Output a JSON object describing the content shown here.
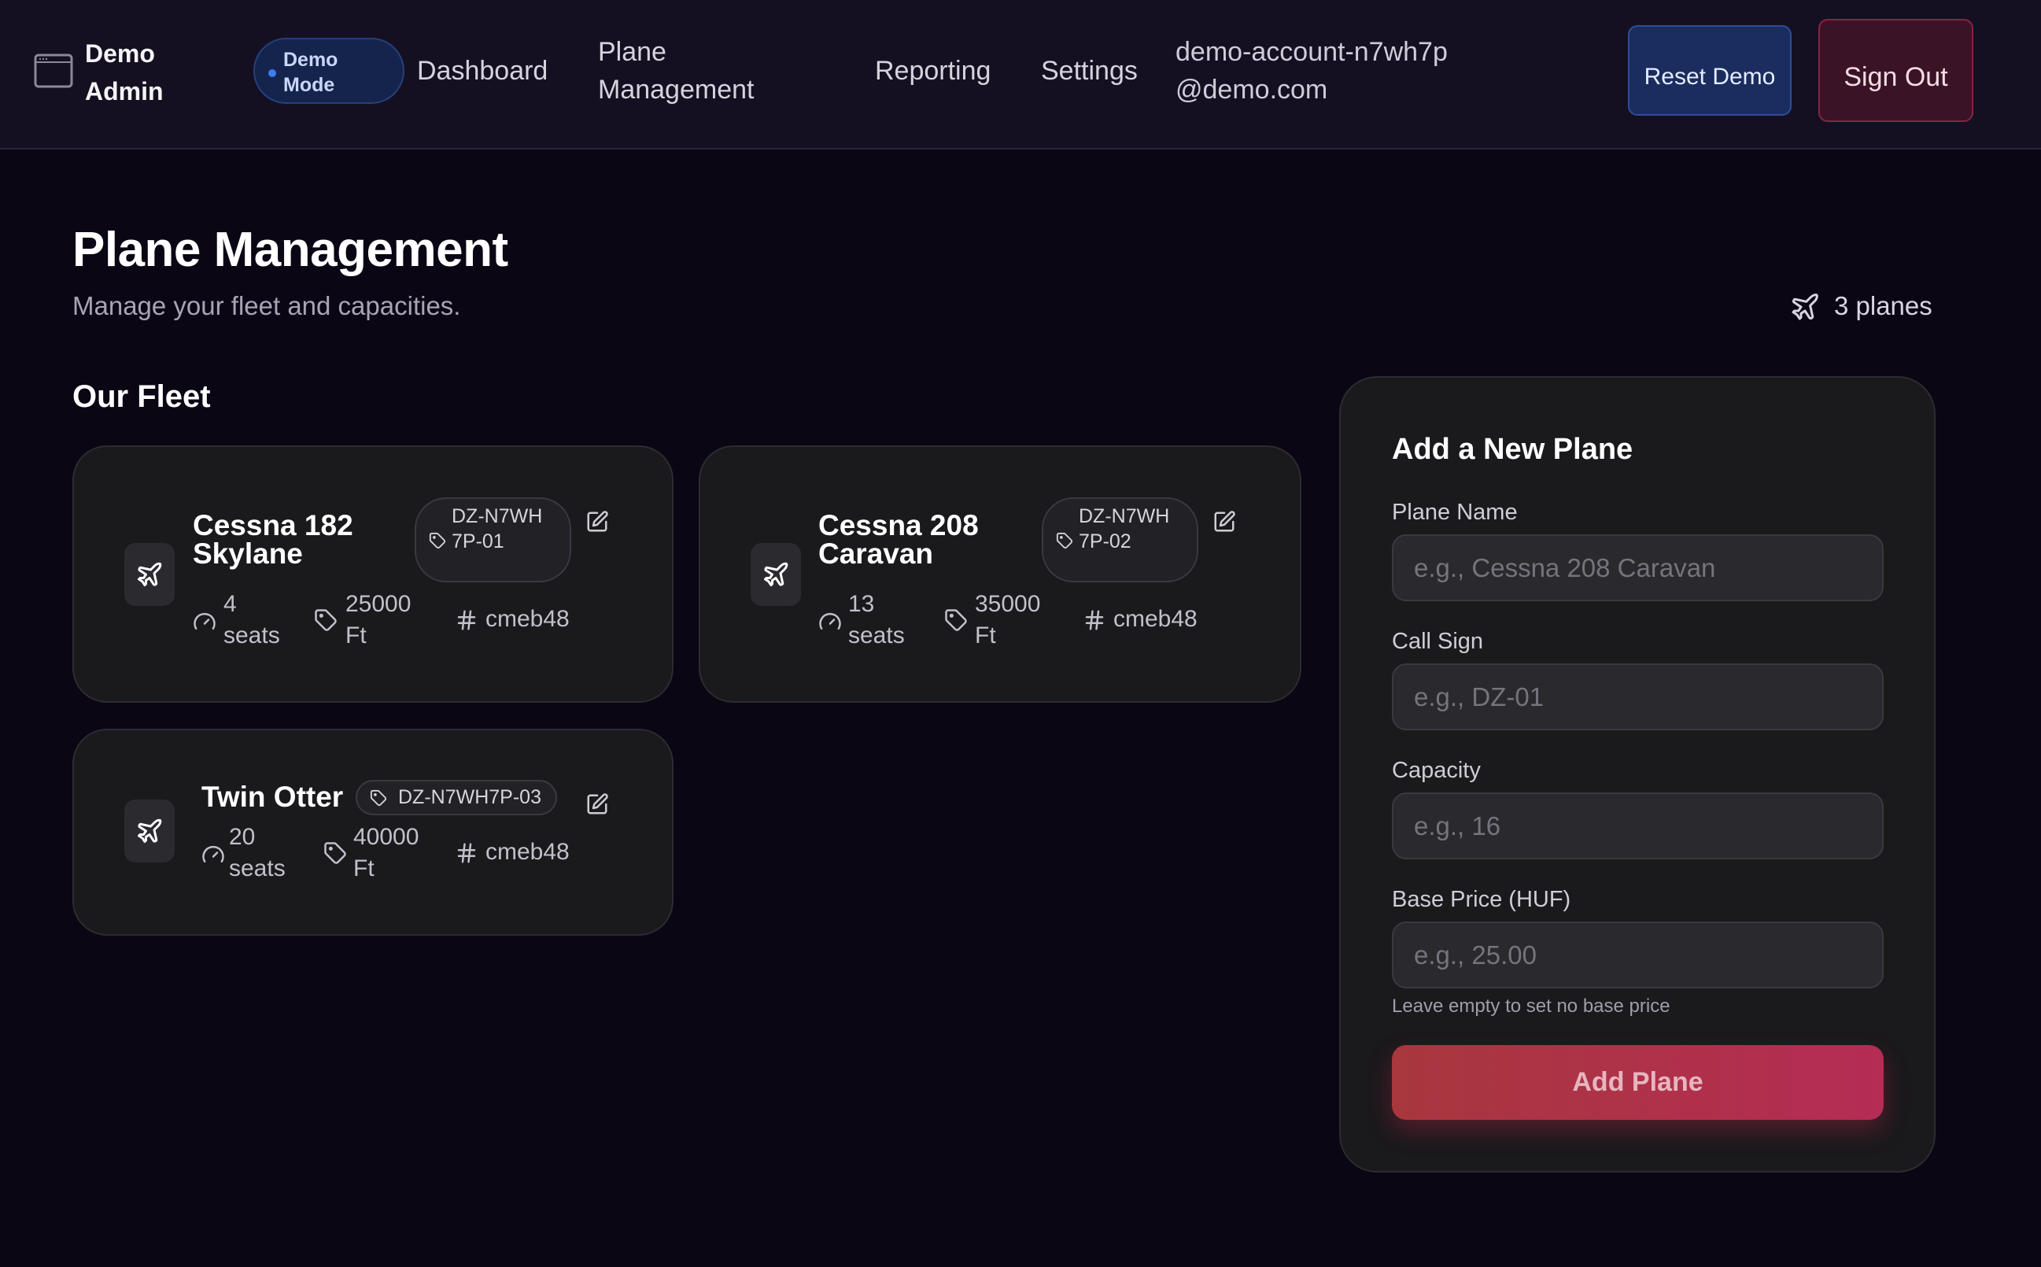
{
  "header": {
    "brand": "Demo Admin",
    "demo_badge": "Demo Mode",
    "nav": {
      "dashboard": "Dashboard",
      "plane_management": "Plane Management",
      "reporting": "Reporting",
      "settings": "Settings"
    },
    "account_email": "demo-account-n7wh7p@demo.com",
    "reset_button": "Reset Demo",
    "signout_button": "Sign Out"
  },
  "page": {
    "title": "Plane Management",
    "subtitle": "Manage your fleet and capacities.",
    "plane_count": "3 planes"
  },
  "fleet": {
    "title": "Our Fleet",
    "planes": [
      {
        "name": "Cessna 182 Skylane",
        "callsign": "DZ-N7WH7P-01",
        "seats": "4 seats",
        "altitude": "25000 Ft",
        "id": "cmeb48"
      },
      {
        "name": "Cessna 208 Caravan",
        "callsign": "DZ-N7WH7P-02",
        "seats": "13 seats",
        "altitude": "35000 Ft",
        "id": "cmeb48"
      },
      {
        "name": "Twin Otter",
        "callsign": "DZ-N7WH7P-03",
        "seats": "20 seats",
        "altitude": "40000 Ft",
        "id": "cmeb48"
      }
    ]
  },
  "form": {
    "title": "Add a New Plane",
    "name_label": "Plane Name",
    "name_placeholder": "e.g., Cessna 208 Caravan",
    "callsign_label": "Call Sign",
    "callsign_placeholder": "e.g., DZ-01",
    "capacity_label": "Capacity",
    "capacity_placeholder": "e.g., 16",
    "price_label": "Base Price (HUF)",
    "price_placeholder": "e.g., 25.00",
    "price_hint": "Leave empty to set no base price",
    "submit": "Add Plane"
  },
  "icons": {
    "brand": "window-icon",
    "plane": "plane-icon",
    "tag": "tag-icon",
    "edit": "edit-icon",
    "gauge": "gauge-icon",
    "hash": "hash-icon"
  },
  "colors": {
    "background": "#0b0613",
    "card": "#1a191c",
    "demo_accent": "#3d7cf2",
    "danger": "#b52c54"
  }
}
